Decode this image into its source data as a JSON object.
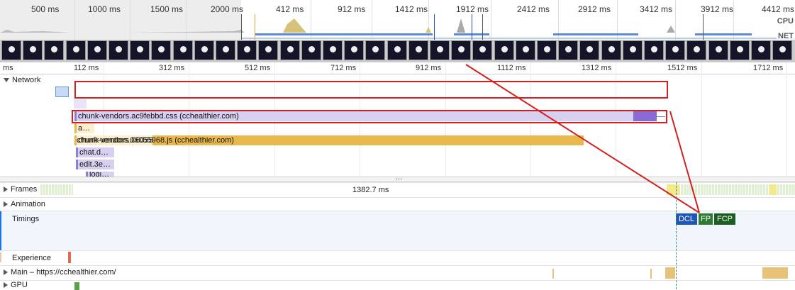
{
  "overview": {
    "labels": [
      "500 ms",
      "1000 ms",
      "1500 ms",
      "2000 ms",
      "412 ms",
      "912 ms",
      "1412 ms",
      "1912 ms",
      "2412 ms",
      "2912 ms",
      "3412 ms",
      "3912 ms",
      "4412 ms"
    ],
    "cpu_tag": "CPU",
    "net_tag": "NET"
  },
  "ruler": {
    "labels": [
      "ms",
      "112 ms",
      "312 ms",
      "512 ms",
      "712 ms",
      "912 ms",
      "1112 ms",
      "1312 ms",
      "1512 ms",
      "1712 ms"
    ]
  },
  "network": {
    "title": "Network",
    "requests": [
      {
        "label": "chunk-vendors.ac9febbd.css (cchealthier.com)",
        "type": "css"
      },
      {
        "label": "a…",
        "type": "js"
      },
      {
        "label": "chunk-vendors.06055968.js (cchealthier.com)",
        "type": "js"
      },
      {
        "label": "chat.d…",
        "type": "css"
      },
      {
        "label": "edit.3e…",
        "type": "css"
      },
      {
        "label": "logi…",
        "type": "css"
      }
    ],
    "more_indicator": "..."
  },
  "tracks": {
    "frames": "Frames",
    "frames_duration": "1382.7 ms",
    "animation": "Animation",
    "timings": "Timings",
    "experience": "Experience",
    "main": "Main – https://cchealthier.com/",
    "gpu": "GPU"
  },
  "timings_markers": [
    {
      "label": "DCL",
      "color": "#1f57b8"
    },
    {
      "label": "FP",
      "color": "#2e7d32"
    },
    {
      "label": "FCP",
      "color": "#1b5e20"
    }
  ],
  "colors": {
    "annotation_red": "#d42020",
    "css_bar": "#d8d0f0",
    "js_bar": "#e9b84c"
  }
}
